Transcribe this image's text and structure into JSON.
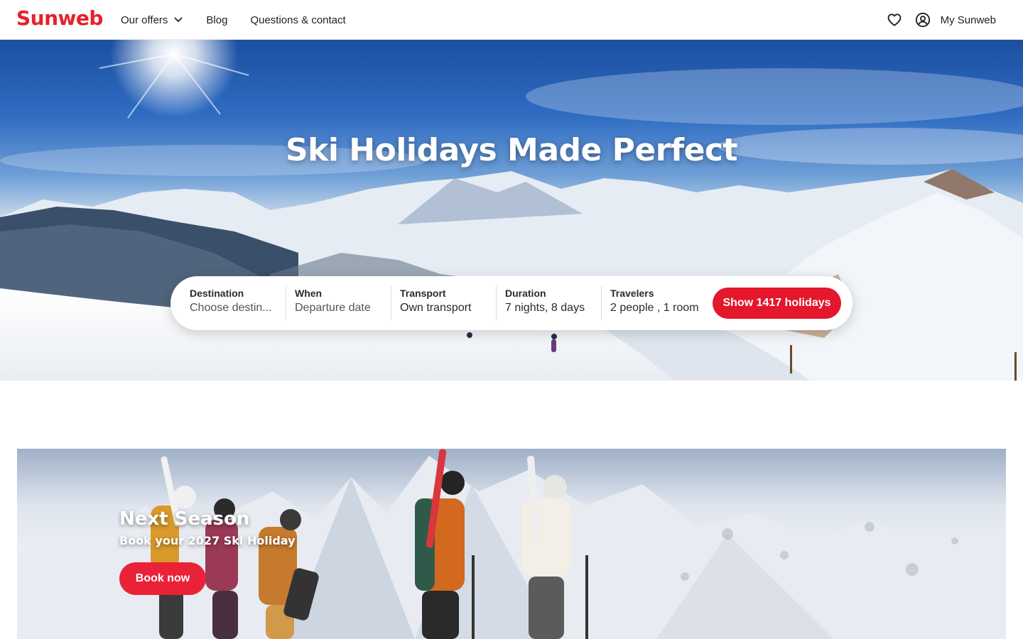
{
  "brand": {
    "logo_text": "Sunweb",
    "accent_color": "#e8202a",
    "button_color": "#e4172c"
  },
  "nav": {
    "items": [
      {
        "label": "Our offers",
        "has_dropdown": true
      },
      {
        "label": "Blog"
      },
      {
        "label": "Questions & contact"
      }
    ],
    "favorites_icon": "heart-icon",
    "account_icon": "user-circle-icon",
    "account_label": "My Sunweb"
  },
  "hero": {
    "title": "Ski Holidays Made Perfect",
    "search": {
      "destination": {
        "label": "Destination",
        "value": "Choose destin..."
      },
      "when": {
        "label": "When",
        "value": "Departure date"
      },
      "transport": {
        "label": "Transport",
        "value": "Own transport"
      },
      "duration": {
        "label": "Duration",
        "value": "7 nights, 8 days"
      },
      "travelers": {
        "label": "Travelers",
        "value": "2 people , 1 room"
      },
      "submit_label": "Show 1417 holidays"
    }
  },
  "promo": {
    "title": "Next Season",
    "subtitle": "Book your 2027 Ski Holiday",
    "button_label": "Book now"
  }
}
